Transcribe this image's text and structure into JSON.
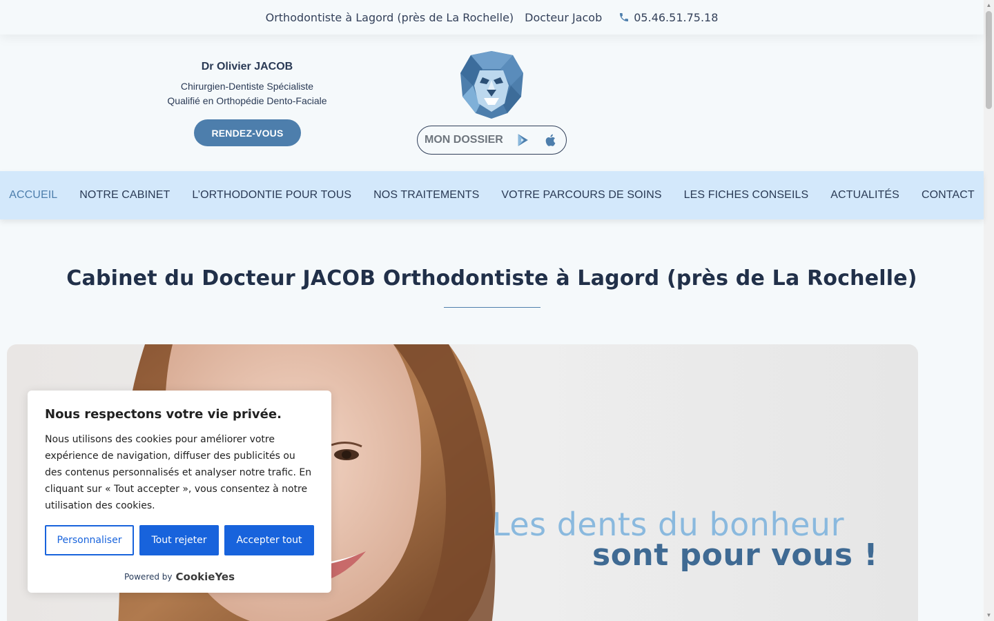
{
  "topbar": {
    "location": "Orthodontiste à Lagord (près de La Rochelle)",
    "doctor": "Docteur Jacob",
    "phone": "05.46.51.75.18"
  },
  "header": {
    "doctor_name": "Dr Olivier JACOB",
    "line1": "Chirurgien-Dentiste Spécialiste",
    "line2": "Qualifié en Orthopédie Dento-Faciale",
    "rdv_label": "RENDEZ-VOUS",
    "dossier_label": "MON DOSSIER"
  },
  "nav": {
    "items": [
      {
        "label": "ACCUEIL",
        "active": true
      },
      {
        "label": "NOTRE CABINET"
      },
      {
        "label": "L’ORTHODONTIE POUR TOUS"
      },
      {
        "label": "NOS TRAITEMENTS"
      },
      {
        "label": "VOTRE PARCOURS DE SOINS"
      },
      {
        "label": "LES FICHES CONSEILS"
      },
      {
        "label": "ACTUALITÉS"
      },
      {
        "label": "CONTACT"
      }
    ]
  },
  "main": {
    "title": "Cabinet du Docteur JACOB Orthodontiste à Lagord (près de La Rochelle)",
    "hero_line1": "Les dents du bonheur",
    "hero_line2": "sont pour vous !"
  },
  "cookie": {
    "title": "Nous respectons votre vie privée.",
    "body": "Nous utilisons des cookies pour améliorer votre expérience de navigation, diffuser des publicités ou des contenus personnalisés et analyser notre trafic. En cliquant sur « Tout accepter », vous consentez à notre utilisation des cookies.",
    "customize": "Personnaliser",
    "reject": "Tout rejeter",
    "accept": "Accepter tout",
    "powered_by": "Powered by",
    "brand": "CookieYes"
  },
  "colors": {
    "accent": "#4d7eac",
    "nav_bg": "#d3e8fb",
    "cookie_blue": "#1863dc"
  },
  "icons": [
    "phone-icon",
    "lion-logo",
    "google-play-icon",
    "apple-icon"
  ]
}
